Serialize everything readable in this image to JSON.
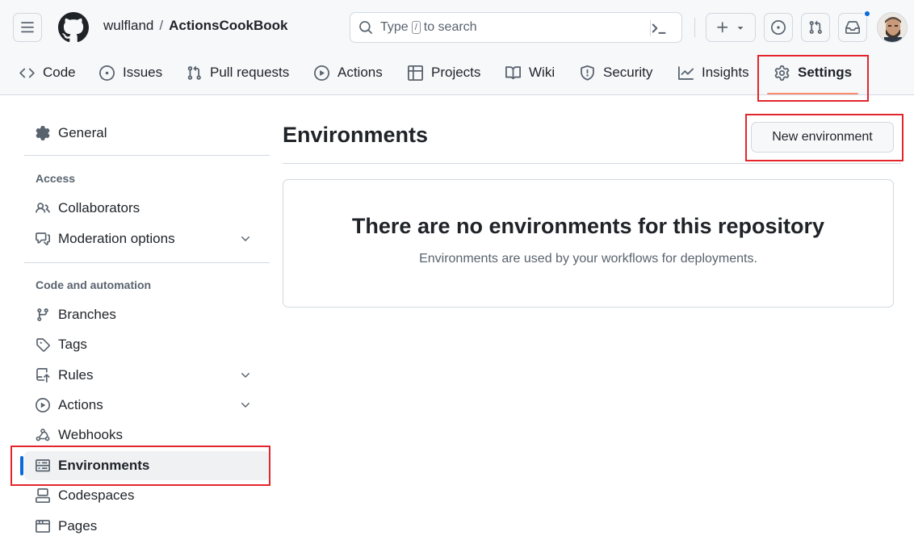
{
  "header": {
    "owner": "wulfland",
    "separator": "/",
    "repo": "ActionsCookBook",
    "search": {
      "prefix": "Type",
      "key": "/",
      "suffix": "to search"
    }
  },
  "tabs": [
    {
      "label": "Code",
      "icon": "code-icon"
    },
    {
      "label": "Issues",
      "icon": "issue-opened-icon"
    },
    {
      "label": "Pull requests",
      "icon": "git-pull-request-icon"
    },
    {
      "label": "Actions",
      "icon": "play-icon"
    },
    {
      "label": "Projects",
      "icon": "table-icon"
    },
    {
      "label": "Wiki",
      "icon": "book-icon"
    },
    {
      "label": "Security",
      "icon": "shield-icon"
    },
    {
      "label": "Insights",
      "icon": "graph-icon"
    },
    {
      "label": "Settings",
      "icon": "gear-icon",
      "active": true
    }
  ],
  "sidebar": {
    "general": "General",
    "access_heading": "Access",
    "collaborators": "Collaborators",
    "moderation": "Moderation options",
    "code_heading": "Code and automation",
    "branches": "Branches",
    "tags": "Tags",
    "rules": "Rules",
    "actions": "Actions",
    "webhooks": "Webhooks",
    "environments": "Environments",
    "codespaces": "Codespaces",
    "pages": "Pages",
    "selected": "Environments"
  },
  "main": {
    "title": "Environments",
    "new_button": "New environment",
    "blankslate_title": "There are no environments for this repository",
    "blankslate_text": "Environments are used by your workflows for deployments."
  },
  "colors": {
    "accent_blue": "#0969da",
    "active_tab_underline": "#fd8c73",
    "highlight_red": "#e3262c",
    "header_bg": "#f6f8fa"
  }
}
